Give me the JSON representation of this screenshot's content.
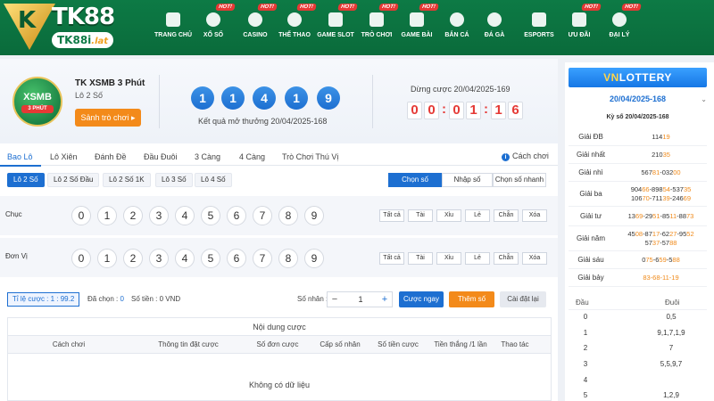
{
  "brand": {
    "logo_main": "TK88",
    "logo_sub": "TK88i",
    "logo_tld": ".lat"
  },
  "nav": [
    {
      "label": "TRANG CHỦ",
      "hot": ""
    },
    {
      "label": "XỔ SỐ",
      "hot": "HOT!"
    },
    {
      "label": "CASINO",
      "hot": "HOT!"
    },
    {
      "label": "THỂ THAO",
      "hot": "HOT!"
    },
    {
      "label": "GAME SLOT",
      "hot": "HOT!"
    },
    {
      "label": "TRÒ CHƠI",
      "hot": "HOT!"
    },
    {
      "label": "GAME BÀI",
      "hot": "HOT!"
    },
    {
      "label": "BẮN CÁ",
      "hot": ""
    },
    {
      "label": "ĐÁ GÀ",
      "hot": ""
    },
    {
      "label": "ESPORTS",
      "hot": ""
    },
    {
      "label": "ƯU ĐÃI",
      "hot": "HOT!"
    },
    {
      "label": "ĐẠI LÝ",
      "hot": "HOT!"
    }
  ],
  "game": {
    "badge_title": "XSMB",
    "badge_sub": "3 PHÚT",
    "title": "TK XSMB 3 Phút",
    "subtitle": "Lô 2 Số",
    "lobby_button": "Sảnh trò chơi ▸",
    "result_balls": [
      "1",
      "1",
      "4",
      "1",
      "9"
    ],
    "result_label": "Kết quả mở thưởng 20/04/2025-168",
    "stop_label": "Dừng cược 20/04/2025-169",
    "countdown": [
      "0",
      "0",
      "0",
      "1",
      "1",
      "6"
    ]
  },
  "tabs": [
    "Bao Lô",
    "Lô Xiên",
    "Đánh Đề",
    "Đầu Đuôi",
    "3 Càng",
    "4 Càng",
    "Trò Chơi Thú Vị"
  ],
  "howto": "Cách chơi",
  "subtabs": [
    "Lô 2 Số",
    "Lô 2 Số Đầu",
    "Lô 2 Số 1K",
    "Lô 3 Số",
    "Lô 4 Số"
  ],
  "modes": [
    "Chọn số",
    "Nhập số",
    "Chọn số nhanh"
  ],
  "rows": [
    {
      "label": "Chục"
    },
    {
      "label": "Đơn Vị"
    }
  ],
  "numbers": [
    "0",
    "1",
    "2",
    "3",
    "4",
    "5",
    "6",
    "7",
    "8",
    "9"
  ],
  "quick_buttons": [
    "Tất cả",
    "Tài",
    "Xỉu",
    "Lẻ",
    "Chẵn",
    "Xóa"
  ],
  "bet": {
    "rate": "Tỉ lệ cược : 1 : 99.2",
    "selected_label": "Đã chọn :",
    "selected_value": "0",
    "amount_label": "Số tiền :",
    "amount_value": "0 VND",
    "multiplier_label": "Số nhân :",
    "minus": "−",
    "plus": "+",
    "multiplier_value": "1",
    "bet_now": "Cược ngay",
    "add_number": "Thêm số",
    "reset": "Cài đặt lại"
  },
  "content": {
    "title": "Nội dung cược",
    "columns": [
      "Cách chơi",
      "Thông tin đặt cược",
      "Số đơn cược",
      "Cấp số nhân",
      "Số tiền cược",
      "Tiền thắng /1 lần",
      "Thao tác"
    ],
    "empty": "Không có dữ liệu"
  },
  "right": {
    "vnlottery_a": "VN",
    "vnlottery_b": "LOTTERY",
    "date": "20/04/2025-168",
    "kyso": "Kỳ số 20/04/2025-168",
    "prizes": [
      {
        "label": "Giải ĐB",
        "values": [
          "11419"
        ]
      },
      {
        "label": "Giải nhất",
        "values": [
          "21035"
        ]
      },
      {
        "label": "Giải nhì",
        "values": [
          "56781-03200"
        ]
      },
      {
        "label": "Giải ba",
        "values": [
          "90466-89854-53735",
          "10670-71139-24669"
        ]
      },
      {
        "label": "Giải tư",
        "values": [
          "1369-2951-8511-8873"
        ]
      },
      {
        "label": "Giải năm",
        "values": [
          "4508-8717-6227-9552",
          "5737-5788"
        ]
      },
      {
        "label": "Giải sáu",
        "values": [
          "075-659-588"
        ]
      },
      {
        "label": "Giải bảy",
        "values": [
          "83-68-11-19"
        ]
      }
    ],
    "dd_head": [
      "Đầu",
      "Đuôi"
    ],
    "dd_rows": [
      {
        "dau": "0",
        "duoi": "0,5"
      },
      {
        "dau": "1",
        "duoi": "9,1,7,1,9"
      },
      {
        "dau": "2",
        "duoi": "7"
      },
      {
        "dau": "3",
        "duoi": "5,5,9,7"
      },
      {
        "dau": "4",
        "duoi": ""
      },
      {
        "dau": "5",
        "duoi": "1,2,9"
      }
    ]
  }
}
